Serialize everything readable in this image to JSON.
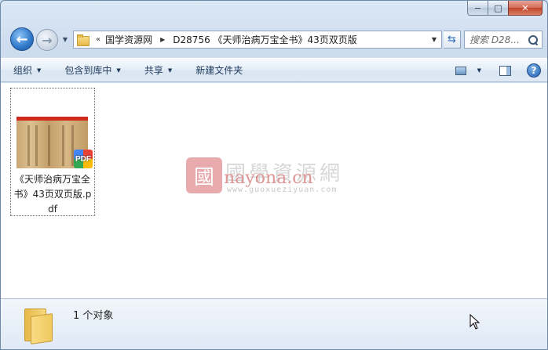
{
  "window": {
    "caption": {
      "minimize": "−",
      "maximize": "□",
      "close": "✕"
    }
  },
  "nav": {
    "back_icon": "back-arrow-icon",
    "forward_icon": "forward-arrow-icon",
    "breadcrumb": {
      "overflow": "«",
      "items": [
        "国学资源网",
        "D28756 《天师治病万宝全书》43页双页版"
      ]
    },
    "search_placeholder": "搜索 D28..."
  },
  "command_bar": {
    "organize": "组织",
    "include_in_library": "包含到库中",
    "share": "共享",
    "new_folder": "新建文件夹"
  },
  "files": [
    {
      "name": "《天师治病万宝全书》43页双页版.pdf",
      "thumb_header": "PDF",
      "badge": "PDF"
    }
  ],
  "watermark": {
    "logo": "國",
    "title": "國學資源網",
    "red_text": "nayona.cn",
    "url": "www.guoxueziyuan.com"
  },
  "details": {
    "summary": "1 个对象"
  },
  "colors": {
    "window_frame": "#c9daee",
    "close_button": "#c3452b",
    "accent": "#2f77c8"
  }
}
